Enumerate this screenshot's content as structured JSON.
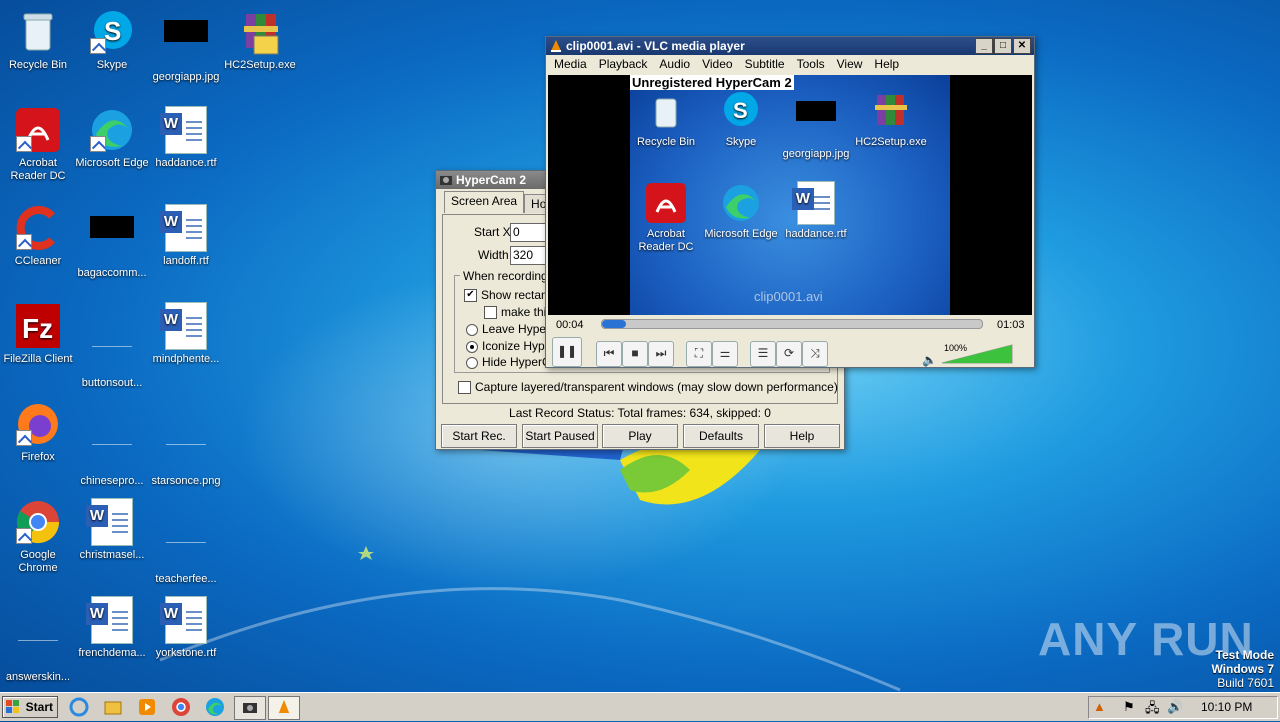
{
  "desktop": {
    "icons": [
      {
        "label": "Recycle Bin"
      },
      {
        "label": "Skype"
      },
      {
        "label": "georgiapp.jpg"
      },
      {
        "label": "HC2Setup.exe"
      },
      {
        "label": "Acrobat Reader DC"
      },
      {
        "label": "Microsoft Edge"
      },
      {
        "label": "haddance.rtf"
      },
      {
        "label": "CCleaner"
      },
      {
        "label": "bagaccomm..."
      },
      {
        "label": "landoff.rtf"
      },
      {
        "label": "FileZilla Client"
      },
      {
        "label": "buttonsout..."
      },
      {
        "label": "mindphente..."
      },
      {
        "label": "Firefox"
      },
      {
        "label": "chinesepro..."
      },
      {
        "label": "starsonce.png"
      },
      {
        "label": "Google Chrome"
      },
      {
        "label": "christmasel..."
      },
      {
        "label": "teacherfee..."
      },
      {
        "label": "answerskin..."
      },
      {
        "label": "frenchdema..."
      },
      {
        "label": "yorkstone.rtf"
      }
    ],
    "watermark": {
      "brand": "ANY RUN",
      "test_mode": "Test Mode",
      "os": "Windows 7",
      "build": "Build 7601"
    }
  },
  "hypercam": {
    "title": "HyperCam 2",
    "tabs": [
      "Screen Area",
      "Hot K"
    ],
    "start_x_label": "Start X",
    "start_x_value": "0",
    "width_label": "Width",
    "width_value": "320",
    "group_label": "When recording:",
    "show_rect_label": "Show rectang",
    "make_label": "make thi",
    "leave_label": "Leave Hyper",
    "iconize_label": "Iconize Hype",
    "hide_label": "Hide HyperC",
    "capture_label": "Capture layered/transparent windows (may slow down performance)",
    "status": "Last Record Status: Total frames: 634, skipped: 0",
    "buttons": [
      "Start Rec.",
      "Start Paused",
      "Play",
      "Defaults",
      "Help"
    ]
  },
  "vlc": {
    "title": "clip0001.avi - VLC media player",
    "menu": [
      "Media",
      "Playback",
      "Audio",
      "Video",
      "Subtitle",
      "Tools",
      "View",
      "Help"
    ],
    "overlay_text": "Unregistered HyperCam 2",
    "video_icons": [
      "Recycle Bin",
      "Skype",
      "georgiapp.jpg",
      "HC2Setup.exe",
      "Acrobat Reader DC",
      "Microsoft Edge",
      "haddance.rtf"
    ],
    "video_watermark": "clip0001.avi",
    "time_elapsed": "00:04",
    "time_total": "01:03",
    "progress": 0.063,
    "volume": "100%",
    "volume_level": 1.0
  },
  "taskbar": {
    "start_label": "Start",
    "clock": "10:10 PM"
  }
}
